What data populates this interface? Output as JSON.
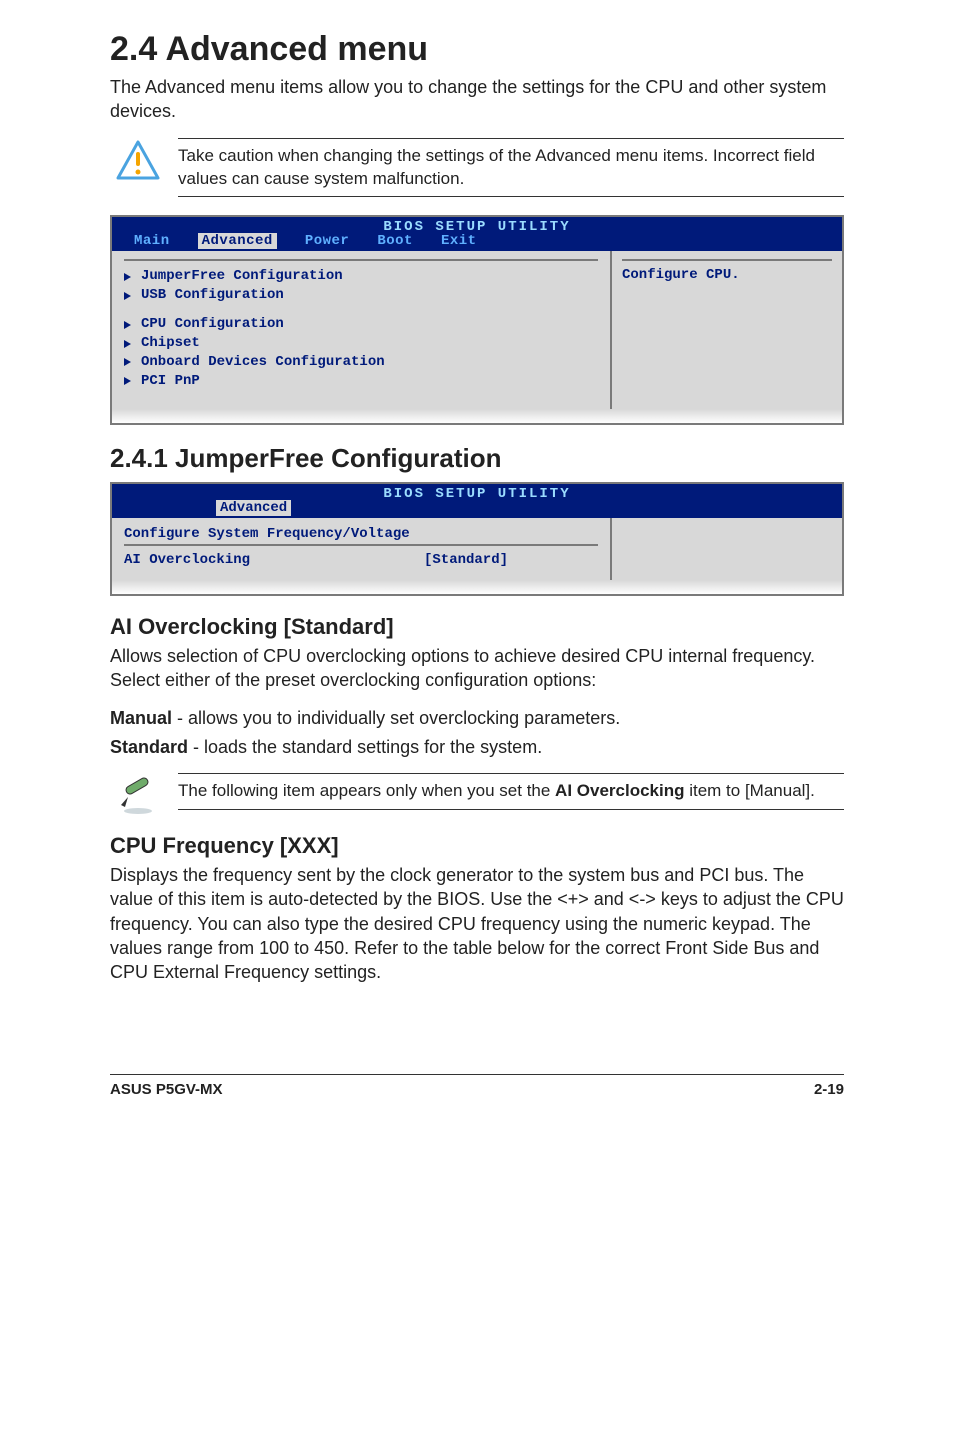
{
  "heading": {
    "number_name": "2.4    Advanced menu"
  },
  "intro": "The Advanced menu items allow you to change the settings for the CPU and other system devices.",
  "caution_note": "Take caution when changing the settings of the Advanced menu items. Incorrect field values can cause system malfunction.",
  "bios1": {
    "top_title": "BIOS SETUP UTILITY",
    "tabs": {
      "main": "Main",
      "advanced": "Advanced",
      "power": "Power",
      "boot": "Boot",
      "exit": "Exit"
    },
    "left_items_a": [
      "JumperFree Configuration",
      "USB Configuration"
    ],
    "left_items_b": [
      "CPU Configuration",
      "Chipset",
      "Onboard Devices Configuration",
      "PCI PnP"
    ],
    "right_text": "Configure CPU."
  },
  "sub1": {
    "title": "2.4.1   JumperFree Configuration"
  },
  "bios2": {
    "top_title": "BIOS SETUP UTILITY",
    "active_tab": "Advanced",
    "subheading": "Configure System Frequency/Voltage",
    "row_label": "AI Overclocking",
    "row_value": "[Standard]"
  },
  "aioc": {
    "title": "AI Overclocking [Standard]",
    "desc": "Allows selection of CPU overclocking options to achieve desired CPU internal frequency. Select either of the preset overclocking configuration options:",
    "manual_label": "Manual",
    "manual_text": " - allows you to individually set overclocking parameters.",
    "standard_label": "Standard",
    "standard_text": " - loads the standard settings for the system."
  },
  "pencil_note": {
    "pre": "The following item appears only when you set the ",
    "bold": "AI Overclocking",
    "post": " item to [Manual]."
  },
  "cpuf": {
    "title": "CPU Frequency [XXX]",
    "desc": "Displays the frequency sent by the clock generator to the system bus and PCI bus. The value of this item is auto-detected by the BIOS. Use the <+> and <-> keys to adjust the CPU frequency. You can also type the desired CPU frequency using the numeric keypad. The values range from 100 to 450. Refer to the table below for the correct Front Side Bus and CPU External Frequency settings."
  },
  "footer": {
    "left": "ASUS P5GV-MX",
    "right": "2-19"
  }
}
